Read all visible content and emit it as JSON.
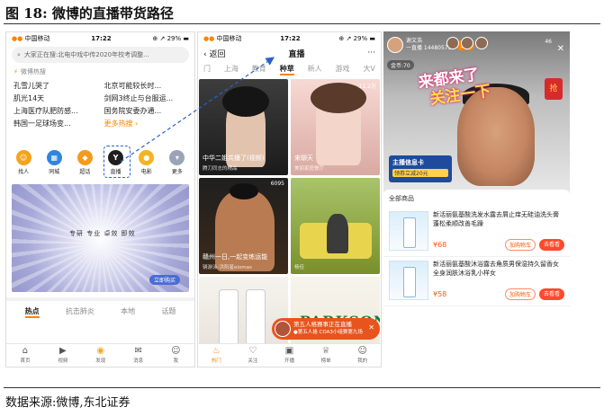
{
  "figure": {
    "label": "图 18:",
    "title": "微博的直播带货路径",
    "source": "数据来源:微博,东北证券"
  },
  "screen1": {
    "status": {
      "carrier": "中国移动",
      "time": "17:22",
      "battery": "29%"
    },
    "search_placeholder": "大家正在搜:北电中戏中传2020年校考调整...",
    "hot_header": "微博热搜",
    "hot_items": [
      "孔雪儿哭了",
      "北京可能较长时...",
      "肌光14天",
      "剑网3终止与台服运...",
      "上海医疗队肥防感...",
      "国务院安委办通...",
      "韩国一足球场变...",
      "更多热搜"
    ],
    "icons": [
      {
        "label": "找人",
        "glyph": "person-icon",
        "color": "#f4a31b"
      },
      {
        "label": "同城",
        "glyph": "city-icon",
        "color": "#2f86de"
      },
      {
        "label": "超话",
        "glyph": "diamond-icon",
        "color": "#f59a1b"
      },
      {
        "label": "直播",
        "glyph": "live-icon",
        "color": "#1f1f1f"
      },
      {
        "label": "电影",
        "glyph": "film-icon",
        "color": "#f5b321"
      },
      {
        "label": "更多",
        "glyph": "more-icon",
        "color": "#9aa4b8"
      }
    ],
    "banner_text": "专研 专业 卓效 即效",
    "banner_button": "立即购买",
    "tabs": [
      "热点",
      "抗击肺炎",
      "本地",
      "话题"
    ],
    "nav": [
      "首页",
      "视频",
      "发现",
      "消息",
      "我"
    ]
  },
  "screen2": {
    "status": {
      "carrier": "中国移动",
      "time": "17:22",
      "battery": "29%"
    },
    "back": "返回",
    "title": "直播",
    "menu": "···",
    "tabs": [
      "门",
      "上海",
      "教育",
      "种草",
      "新人",
      "游戏",
      "大V"
    ],
    "active_tab": "种草",
    "tiles": [
      {
        "caption": "中华二姐共播了(视频)",
        "sub": "腾刀同志的精品",
        "count": ""
      },
      {
        "caption": "来聊天",
        "sub": "美丽家庭餐厅",
        "count": "11.2万"
      },
      {
        "caption": "赣州一日,一起变练运能",
        "sub": "辆游泳-洪阳星eiomas",
        "count": "6095"
      },
      {
        "caption": "",
        "sub": "杨佳",
        "count": ""
      },
      {
        "caption": "",
        "sub": "",
        "count": ""
      },
      {
        "caption": "PARKSON",
        "sub": "",
        "count": ""
      }
    ],
    "popup": {
      "line1": "第五人格赛事正在直播",
      "line2": "●第五人格 COA3小组赛第九场"
    },
    "nav": [
      "热门",
      "关注",
      "开播",
      "榜单",
      "我的"
    ]
  },
  "screen3": {
    "host": {
      "name": "谢文浩",
      "sub": "一直播 14480575"
    },
    "follow": "关注",
    "viewers": "46",
    "gold": "金币:70",
    "promo_line1": "来都来了",
    "promo_line2": "关注一下",
    "redpacket": "抢",
    "info_card": {
      "title": "主播信息卡",
      "sub": "领券立减20元"
    },
    "products_header": "全部商品",
    "products": [
      {
        "name": "新活丽氨基酸洗发水露去屑止痒无硅油洗头膏蓬松柔顺改善毛躁",
        "price": "¥68",
        "cart": "加购物车",
        "buy": "去看看"
      },
      {
        "name": "新活丽氨基酸沐浴露去角质男保湿持久留香女全身润肤沐浴乳小样女",
        "price": "¥58",
        "cart": "加购物车",
        "buy": "去看看"
      }
    ]
  }
}
